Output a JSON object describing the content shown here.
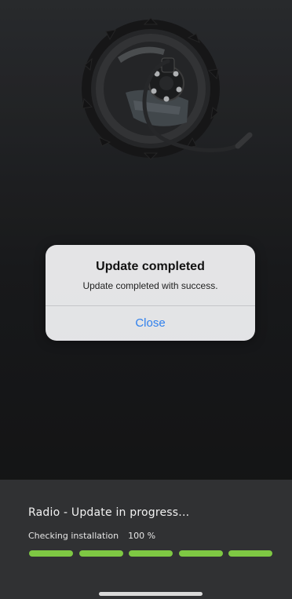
{
  "product_image": {
    "icon": "hub-motor-illustration"
  },
  "dialog": {
    "title": "Update completed",
    "message": "Update completed with success.",
    "close_label": "Close",
    "button_color": "#2f80ed"
  },
  "update_panel": {
    "title": "Radio - Update in progress...",
    "status_label": "Checking installation",
    "percent_label": "100 %",
    "progress_fraction": 1.0,
    "segments_total": 5,
    "segments_filled": 5,
    "accent_color": "#7ec843"
  }
}
